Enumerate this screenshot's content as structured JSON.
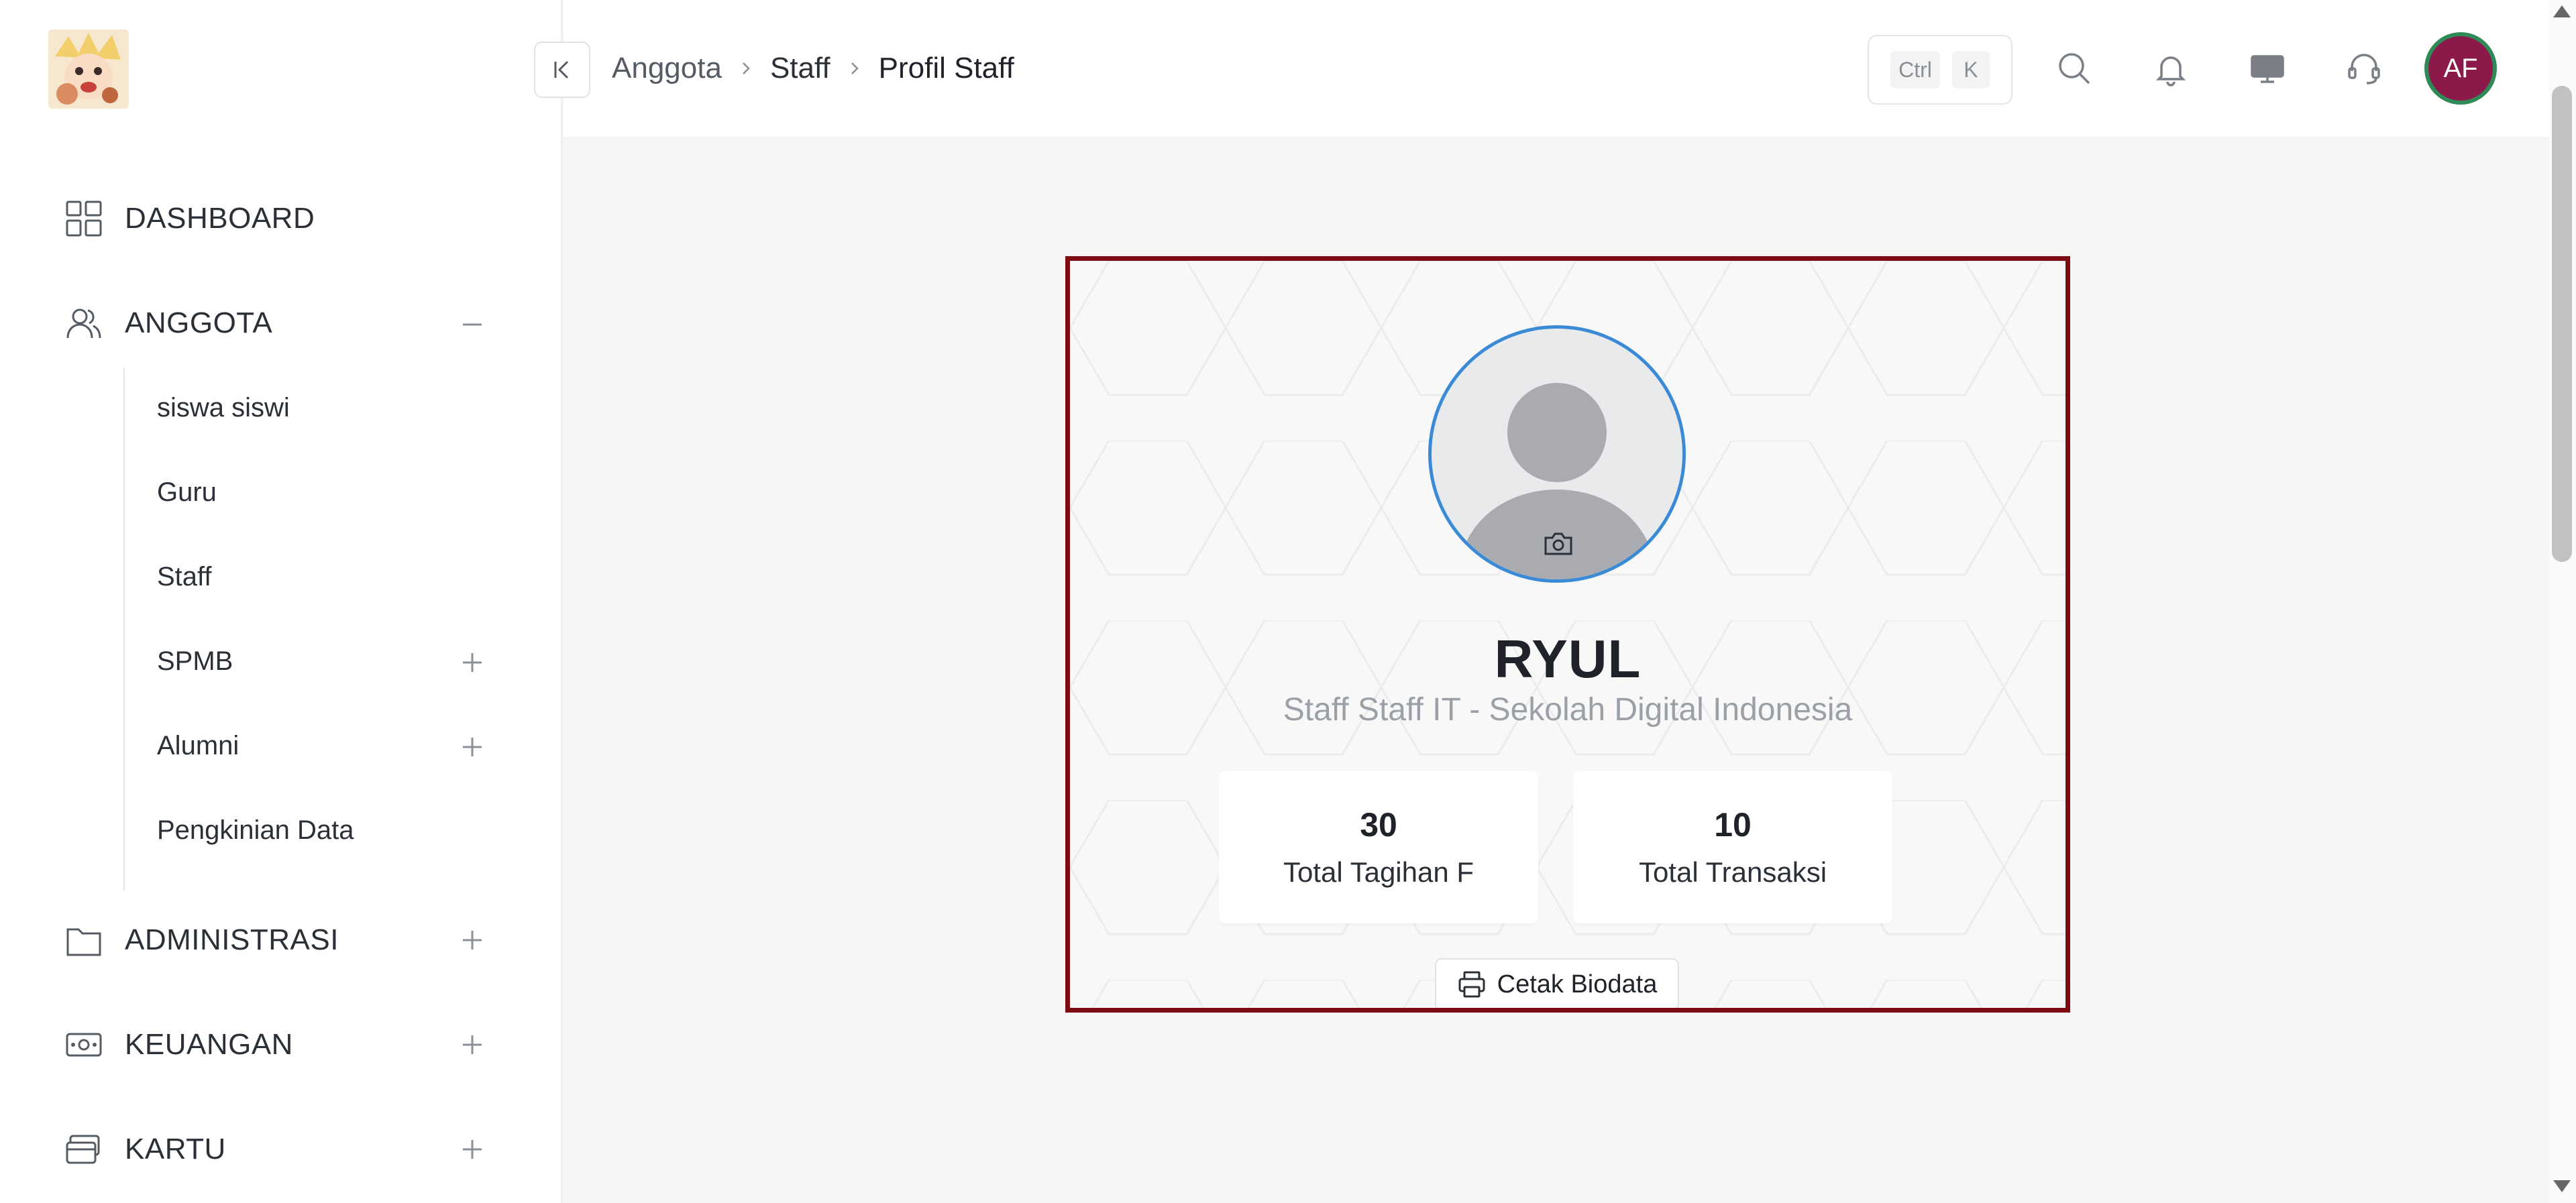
{
  "sidebar": {
    "logo_icon": "anime-avatar-logo",
    "items": [
      {
        "label": "DASHBOARD",
        "icon": "grid-icon"
      },
      {
        "label": "ANGGOTA",
        "icon": "users-icon",
        "toggle": "−"
      },
      {
        "label": "ADMINISTRASI",
        "icon": "folder-icon",
        "toggle": "+"
      },
      {
        "label": "KEUANGAN",
        "icon": "money-icon",
        "toggle": "+"
      },
      {
        "label": "KARTU",
        "icon": "card-icon",
        "toggle": "+"
      }
    ],
    "anggota_sub": [
      {
        "label": "siswa siswi"
      },
      {
        "label": "Guru"
      },
      {
        "label": "Staff"
      },
      {
        "label": "SPMB",
        "toggle": "+"
      },
      {
        "label": "Alumni",
        "toggle": "+"
      },
      {
        "label": "Pengkinian Data"
      }
    ]
  },
  "header": {
    "breadcrumb": [
      "Anggota",
      "Staff",
      "Profil Staff"
    ],
    "shortcut": {
      "key1": "Ctrl",
      "key2": "K"
    },
    "icons": [
      "search-icon",
      "bell-icon",
      "monitor-icon",
      "headset-icon"
    ],
    "avatar_initials": "AF",
    "avatar_color": "#8b1a4a"
  },
  "profile": {
    "name": "RYUL",
    "subtitle": "Staff Staff IT - Sekolah Digital Indonesia",
    "stats": [
      {
        "value": "30",
        "label": "Total Tagihan F"
      },
      {
        "value": "10",
        "label": "Total Transaksi"
      }
    ],
    "print_label": "Cetak Biodata",
    "highlight_color": "#7e0a14"
  }
}
